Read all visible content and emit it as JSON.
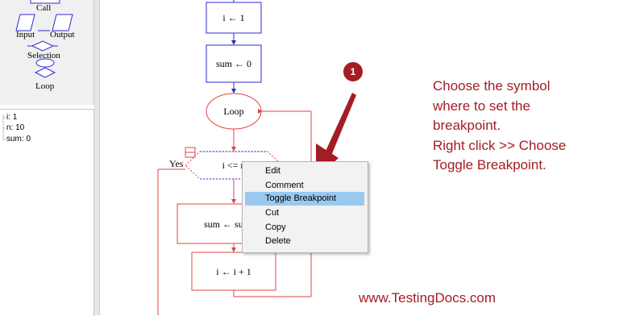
{
  "palette": {
    "call": "Call",
    "input": "Input",
    "output": "Output",
    "selection": "Selection",
    "loop": "Loop"
  },
  "variables": [
    "i: 1",
    "n: 10",
    "sum: 0"
  ],
  "flowchart": {
    "box1": "i ← 1",
    "box2": "sum ← 0",
    "loop": "Loop",
    "decision": "i <= n",
    "yes": "Yes",
    "box3": "sum ← sum + i",
    "box4": "i ← i + 1"
  },
  "context_menu": {
    "items": [
      "Edit",
      "Comment",
      "Toggle Breakpoint",
      "Cut",
      "Copy",
      "Delete"
    ],
    "highlighted": "Toggle Breakpoint"
  },
  "badge": "1",
  "instructions": {
    "line1": "Choose the symbol",
    "line2": "where to set the",
    "line3": "breakpoint.",
    "line4": "Right click >> Choose",
    "line5": "Toggle Breakpoint."
  },
  "footer": "www.TestingDocs.com",
  "colors": {
    "active_shape": "#e04646",
    "normal_shape": "#2b2bd6",
    "accent_red": "#a31d24",
    "menu_highlight": "#99c9ef"
  }
}
